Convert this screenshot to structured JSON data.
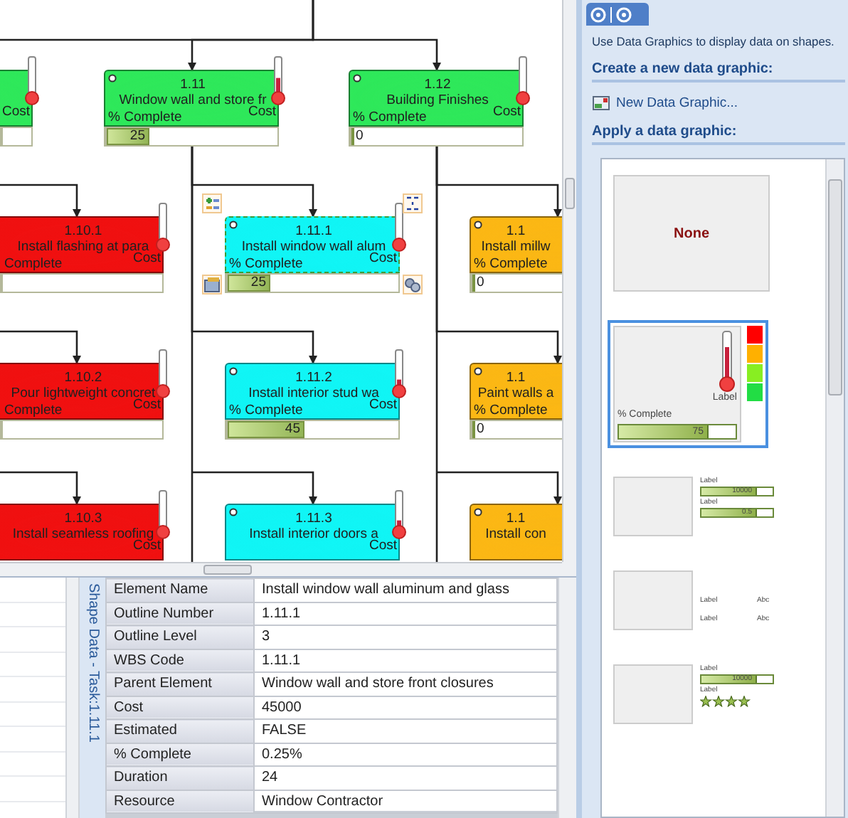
{
  "canvas": {
    "nodes": [
      {
        "color": "#2ee85a",
        "selected": false,
        "cost": {
          "label": "Cost",
          "level": 0.1
        },
        "value_box": true,
        "children": [
          {
            "number": "1.10.1",
            "name": "Install flashing at para",
            "complete_label": "Complete",
            "color": "#f01010",
            "selected": false,
            "cost": {
              "label": "Cost",
              "level": 0.1
            },
            "value_box": true
          },
          {
            "number": "1.10.2",
            "name": "Pour lightweight concret",
            "complete_label": "Complete",
            "color": "#f01010",
            "selected": false,
            "cost": {
              "label": "Cost",
              "level": 0.1
            },
            "value_box": true
          },
          {
            "number": "1.10.3",
            "name": "Install seamless roofing",
            "color": "#f01010",
            "selected": false,
            "cost": {
              "label": "Cost",
              "level": 0.1
            }
          }
        ]
      },
      {
        "number": "1.11",
        "name": "Window wall and store fr",
        "complete_label": "% Complete",
        "color": "#2ee85a",
        "selected": false,
        "cost": {
          "label": "Cost",
          "level": 0.55
        },
        "progress": {
          "value": "25",
          "level": 0.25
        },
        "children": [
          {
            "number": "1.11.1",
            "name": "Install window wall alum",
            "complete_label": "% Complete",
            "color": "#10f5f5",
            "selected": true,
            "cost": {
              "label": "Cost",
              "level": 0.15
            },
            "progress": {
              "value": "25",
              "level": 0.25
            }
          },
          {
            "number": "1.11.2",
            "name": "Install interior stud wa",
            "complete_label": "% Complete",
            "color": "#10f5f5",
            "selected": false,
            "cost": {
              "label": "Cost",
              "level": 0.3
            },
            "progress": {
              "value": "45",
              "level": 0.45
            }
          },
          {
            "number": "1.11.3",
            "name": "Install interior doors a",
            "color": "#10f5f5",
            "selected": false,
            "cost": {
              "label": "Cost",
              "level": 0.3
            }
          }
        ]
      },
      {
        "number": "1.12",
        "name": "Building Finishes",
        "complete_label": "% Complete",
        "color": "#2ee85a",
        "selected": false,
        "cost": {
          "label": "Cost",
          "level": 0.05
        },
        "progress": {
          "value": "0",
          "level": 0
        },
        "children": [
          {
            "number": "1.1",
            "name": "Install millw",
            "complete_label": "% Complete",
            "color": "#fbb714",
            "selected": false,
            "progress": {
              "value": "0",
              "level": 0
            }
          },
          {
            "number": "1.1",
            "name": "Paint walls a",
            "complete_label": "% Complete",
            "color": "#fbb714",
            "selected": false,
            "progress": {
              "value": "0",
              "level": 0
            }
          },
          {
            "number": "1.1",
            "name": "Install con",
            "color": "#fbb714",
            "selected": false
          }
        ]
      }
    ]
  },
  "data_graphics_panel": {
    "description": "Use Data Graphics to display data on shapes.",
    "create_heading": "Create a new data graphic:",
    "new_link": "New Data Graphic...",
    "apply_heading": "Apply a data graphic:",
    "graphics": [
      {
        "kind": "none",
        "label": "None",
        "selected": false
      },
      {
        "kind": "thermometer",
        "label": "Label",
        "bar_label": "% Complete",
        "bar_value": "75",
        "level": 0.75,
        "selected": true
      },
      {
        "kind": "bars",
        "selected": false,
        "items": [
          {
            "label": "Label",
            "value": "10000",
            "level": 0.75
          },
          {
            "label": "Label",
            "value": "0.5",
            "level": 0.75
          }
        ]
      },
      {
        "kind": "text",
        "selected": false,
        "items": [
          {
            "label": "Label",
            "value": "Abc"
          },
          {
            "label": "Label",
            "value": "Abc"
          }
        ]
      },
      {
        "kind": "bar_stars",
        "selected": false,
        "items": [
          {
            "label": "Label",
            "value": "10000",
            "level": 0.75
          },
          {
            "label": "Label",
            "stars": 4
          }
        ]
      }
    ]
  },
  "shape_data": {
    "title": "Shape Data - Task:1.11.1",
    "rows": [
      {
        "label": "Element Name",
        "value": "Install window wall aluminum and glass"
      },
      {
        "label": "Outline Number",
        "value": "1.11.1"
      },
      {
        "label": "Outline Level",
        "value": "3"
      },
      {
        "label": "WBS Code",
        "value": "1.11.1"
      },
      {
        "label": "Parent Element",
        "value": "Window wall and store front closures"
      },
      {
        "label": "Cost",
        "value": "45000"
      },
      {
        "label": "Estimated",
        "value": "FALSE"
      },
      {
        "label": "% Complete",
        "value": "0.25%"
      },
      {
        "label": "Duration",
        "value": "24"
      },
      {
        "label": "Resource",
        "value": "Window Contractor"
      }
    ]
  }
}
